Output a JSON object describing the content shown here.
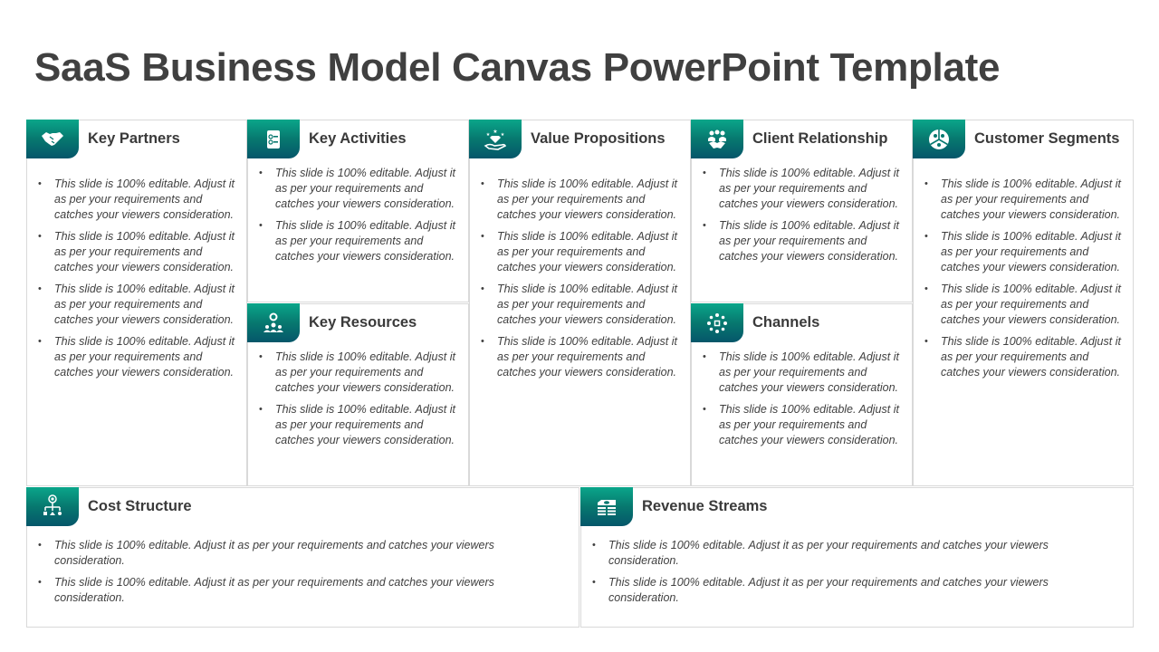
{
  "title": "SaaS Business Model Canvas PowerPoint Template",
  "colors": {
    "accent_top": "#0aa68a",
    "accent_bottom": "#05566a",
    "text": "#404040",
    "border": "#d9d9d9"
  },
  "sections": {
    "key_partners": {
      "icon": "handshake-icon",
      "title": "Key Partners",
      "bullets": [
        "This slide is 100% editable. Adjust it as per your requirements and catches your viewers consideration.",
        "This slide is 100% editable. Adjust it as per your requirements and catches your viewers consideration.",
        "This slide is 100% editable. Adjust it as per your requirements and catches your viewers consideration.",
        "This slide is 100% editable. Adjust it as per your requirements and catches your viewers consideration."
      ]
    },
    "key_activities": {
      "icon": "checklist-icon",
      "title": "Key Activities",
      "bullets": [
        "This slide is 100% editable. Adjust it as per your requirements and catches your viewers consideration.",
        "This slide is 100% editable. Adjust it as per your requirements and catches your viewers consideration."
      ]
    },
    "key_resources": {
      "icon": "team-gear-icon",
      "title": "Key Resources",
      "bullets": [
        "This slide is 100% editable. Adjust it as per your requirements and catches your viewers consideration.",
        "This slide is 100% editable. Adjust it as per your requirements and catches your viewers consideration."
      ]
    },
    "value_propositions": {
      "icon": "hand-diamond-icon",
      "title": "Value Propositions",
      "bullets": [
        "This slide is 100% editable. Adjust it as per your requirements and catches your viewers consideration.",
        "This slide is 100% editable. Adjust it as per your requirements and catches your viewers consideration.",
        "This slide is 100% editable. Adjust it as per your requirements and catches your viewers consideration.",
        "This slide is 100% editable. Adjust it as per your requirements and catches your viewers consideration."
      ]
    },
    "client_relationship": {
      "icon": "people-handshake-icon",
      "title": "Client Relationship",
      "bullets": [
        "This slide is 100% editable. Adjust it as per your requirements and catches your viewers consideration.",
        "This slide is 100% editable. Adjust it as per your requirements and catches your viewers consideration."
      ]
    },
    "channels": {
      "icon": "network-hub-icon",
      "title": "Channels",
      "bullets": [
        "This slide is 100% editable. Adjust it as per your requirements and catches your viewers consideration.",
        "This slide is 100% editable. Adjust it as per your requirements and catches your viewers consideration."
      ]
    },
    "customer_segments": {
      "icon": "segments-pie-icon",
      "title": "Customer Segments",
      "bullets": [
        "This slide is 100% editable. Adjust it as per your requirements and catches your viewers consideration.",
        "This slide is 100% editable. Adjust it as per your requirements and catches your viewers consideration.",
        "This slide is 100% editable. Adjust it as per your requirements and catches your viewers consideration.",
        "This slide is 100% editable. Adjust it as per your requirements and catches your viewers consideration."
      ]
    },
    "cost_structure": {
      "icon": "hierarchy-coin-icon",
      "title": "Cost Structure",
      "bullets": [
        "This slide is 100% editable. Adjust it as per your requirements and catches your viewers consideration.",
        "This slide is 100% editable. Adjust it as per your requirements and catches your viewers consideration."
      ]
    },
    "revenue_streams": {
      "icon": "money-stack-icon",
      "title": "Revenue Streams",
      "bullets": [
        "This slide is 100% editable. Adjust it as per your requirements and catches your viewers consideration.",
        "This slide is 100% editable. Adjust it as per your requirements and catches your viewers consideration."
      ]
    }
  }
}
